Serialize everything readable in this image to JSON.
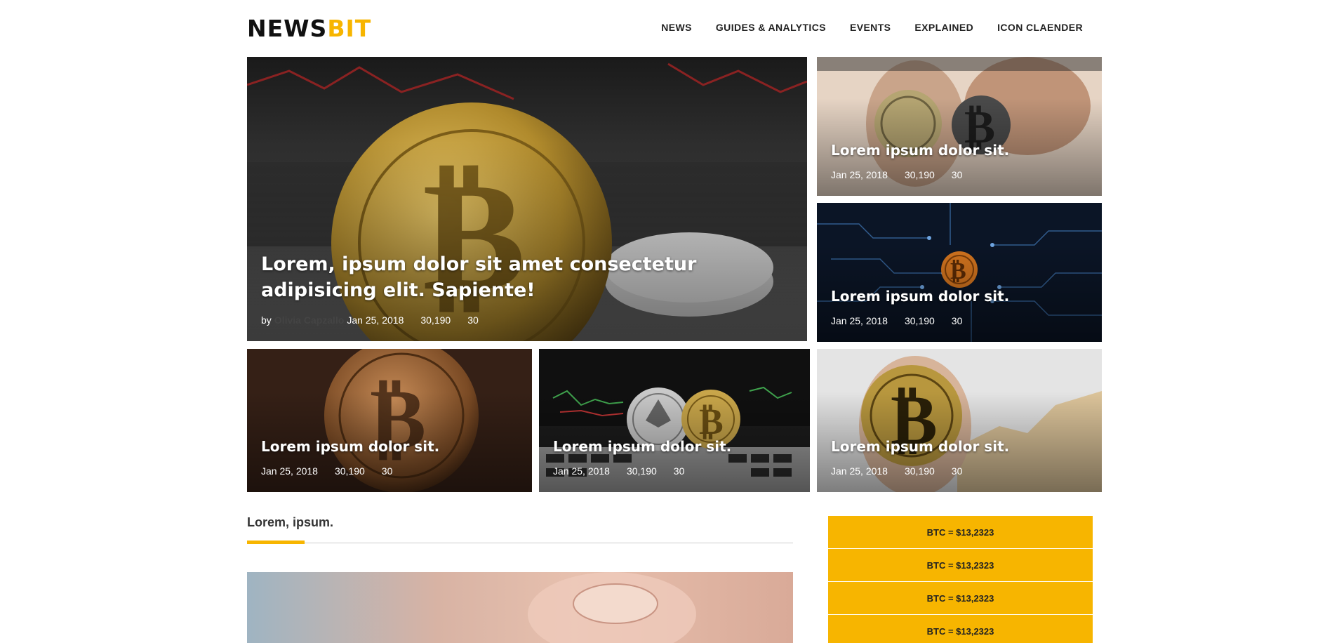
{
  "brand": {
    "part1": "NEWS",
    "part2": "BIT"
  },
  "nav": [
    "NEWS",
    "GUIDES & ANALYTICS",
    "EVENTS",
    "EXPLAINED",
    "ICON CLAENDER"
  ],
  "featured": {
    "title": "Lorem, ipsum dolor sit amet consectetur adipisicing elit. Sapiente!",
    "by": "by",
    "author": "Olivia Capzallo",
    "date": "Jan 25, 2018",
    "views": "30,190",
    "comments": "30"
  },
  "tiles": [
    {
      "title": "Lorem ipsum dolor sit.",
      "date": "Jan 25, 2018",
      "views": "30,190",
      "comments": "30"
    },
    {
      "title": "Lorem ipsum dolor sit.",
      "date": "Jan 25, 2018",
      "views": "30,190",
      "comments": "30"
    },
    {
      "title": "Lorem ipsum dolor sit.",
      "date": "Jan 25, 2018",
      "views": "30,190",
      "comments": "30"
    },
    {
      "title": "Lorem ipsum dolor sit.",
      "date": "Jan 25, 2018",
      "views": "30,190",
      "comments": "30"
    },
    {
      "title": "Lorem ipsum dolor sit.",
      "date": "Jan 25, 2018",
      "views": "30,190",
      "comments": "30"
    }
  ],
  "section": {
    "title": "Lorem, ipsum."
  },
  "prices": [
    "BTC = $13,2323",
    "BTC = $13,2323",
    "BTC = $13,2323",
    "BTC = $13,2323"
  ],
  "colors": {
    "accent": "#f7b500",
    "text": "#222222"
  }
}
